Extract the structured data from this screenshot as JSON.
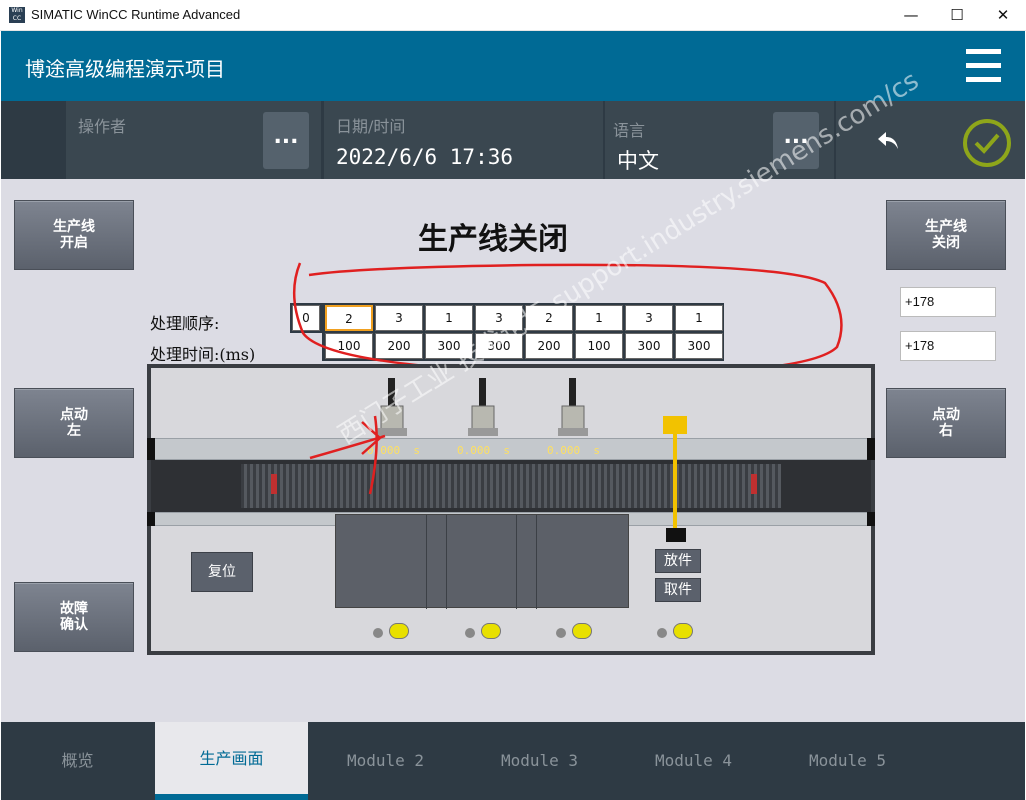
{
  "window": {
    "title": "SIMATIC WinCC Runtime Advanced",
    "logo_text": "WinCC RA",
    "minimize": "—",
    "maximize": "☐",
    "close": "✕"
  },
  "header": {
    "project_title": "博途高级编程演示项目"
  },
  "infobar": {
    "operator_label": "操作者",
    "operator_value": "",
    "datetime_label": "日期/时间",
    "datetime_value": "2022/6/6 17:36",
    "language_label": "语言",
    "language_value": "中文",
    "more": "..."
  },
  "main": {
    "status_text": "生产线关闭",
    "buttons": {
      "line_on": "生产线\n开启",
      "line_off": "生产线\n关闭",
      "jog_left": "点动\n左",
      "jog_right": "点动\n右",
      "fault_ack": "故障\n确认",
      "reset": "复位",
      "place": "放件",
      "take": "取件"
    },
    "seq_label": "处理顺序:",
    "time_label": "处理时间:(ms)",
    "seq_index": "0",
    "sequence": [
      "2",
      "3",
      "1",
      "3",
      "2",
      "1",
      "3",
      "1"
    ],
    "times": [
      "100",
      "200",
      "300",
      "300",
      "200",
      "100",
      "300",
      "300"
    ],
    "readouts": [
      "+178",
      "+178"
    ],
    "timers": [
      "0.000  s",
      "0.000  s",
      "0.000  s"
    ]
  },
  "colors": {
    "brand": "#006a95",
    "annotation": "#e02020",
    "selected": "#f0a020"
  },
  "watermark": "西门子工业 技术论坛 support.industry.siemens.com/cs",
  "tabs": [
    "概览",
    "生产画面",
    "Module 2",
    "Module 3",
    "Module 4",
    "Module 5"
  ],
  "active_tab": "生产画面"
}
